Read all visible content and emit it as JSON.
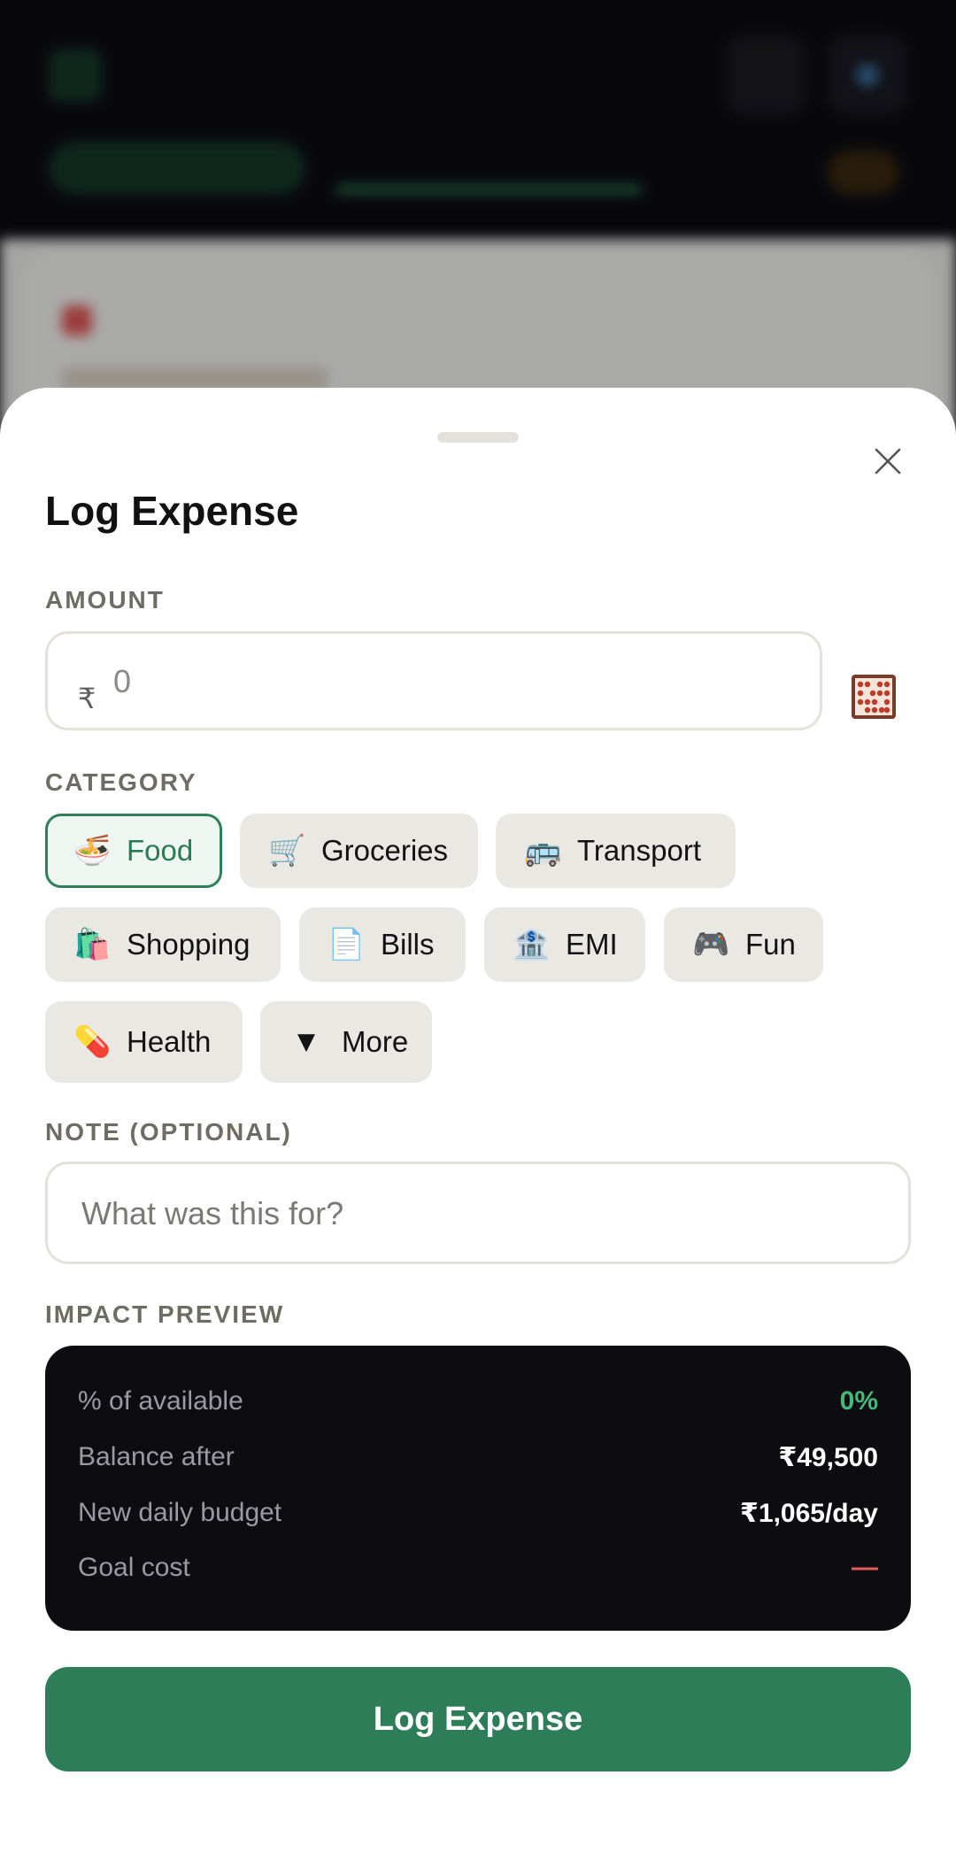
{
  "sheet": {
    "title": "Log Expense",
    "close_icon": "close-icon"
  },
  "amount": {
    "label": "AMOUNT",
    "currency_symbol": "₹",
    "placeholder": "0",
    "calculator_icon": "abacus-icon"
  },
  "category": {
    "label": "CATEGORY",
    "selected": "Food",
    "items": [
      {
        "emoji": "🍜",
        "label": "Food",
        "icon": "noodles-icon"
      },
      {
        "emoji": "🛒",
        "label": "Groceries",
        "icon": "shopping-cart-icon"
      },
      {
        "emoji": "🚌",
        "label": "Transport",
        "icon": "bus-icon"
      },
      {
        "emoji": "🛍️",
        "label": "Shopping",
        "icon": "shopping-bags-icon"
      },
      {
        "emoji": "📄",
        "label": "Bills",
        "icon": "document-icon"
      },
      {
        "emoji": "🏦",
        "label": "EMI",
        "icon": "bank-icon"
      },
      {
        "emoji": "🎮",
        "label": "Fun",
        "icon": "game-controller-icon"
      },
      {
        "emoji": "💊",
        "label": "Health",
        "icon": "pill-icon"
      },
      {
        "emoji": "▼",
        "label": "More",
        "icon": "chevron-down-icon"
      }
    ]
  },
  "note": {
    "label": "NOTE (OPTIONAL)",
    "placeholder": "What was this for?"
  },
  "impact": {
    "label": "IMPACT PREVIEW",
    "rows": [
      {
        "label": "% of available",
        "value": "0%"
      },
      {
        "label": "Balance after",
        "value": "₹49,500"
      },
      {
        "label": "New daily budget",
        "value": "₹1,065/day"
      },
      {
        "label": "Goal cost",
        "value": "—"
      }
    ]
  },
  "submit": {
    "label": "Log Expense"
  },
  "colors": {
    "accent": "#2d7d58",
    "positive": "#46b87a",
    "negative": "#e35d5d",
    "chip_bg": "#e9e8e3",
    "impact_bg": "#0c0c11"
  }
}
